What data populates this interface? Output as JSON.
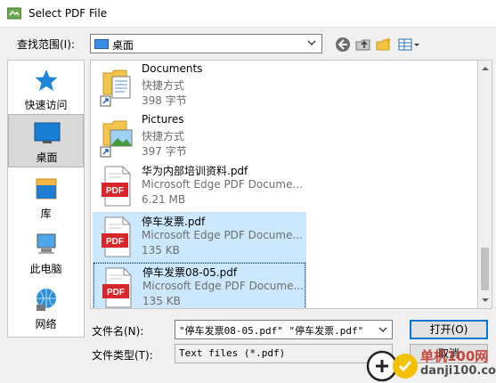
{
  "window": {
    "title": "Select PDF File"
  },
  "toolbar": {
    "lookin_label": "查找范围(I):",
    "lookin_value": "桌面"
  },
  "places": [
    {
      "label": "快速访问",
      "icon": "star-icon"
    },
    {
      "label": "桌面",
      "icon": "desktop-icon",
      "selected": true
    },
    {
      "label": "库",
      "icon": "library-icon"
    },
    {
      "label": "此电脑",
      "icon": "computer-icon"
    },
    {
      "label": "网络",
      "icon": "network-icon"
    }
  ],
  "files": [
    {
      "name": "Documents",
      "type": "快捷方式",
      "size": "398 字节",
      "icon": "shortcut-documents-icon"
    },
    {
      "name": "Pictures",
      "type": "快捷方式",
      "size": "397 字节",
      "icon": "shortcut-pictures-icon"
    },
    {
      "name": "华为内部培训资料.pdf",
      "type": "Microsoft Edge PDF Docume...",
      "size": "6.21 MB",
      "icon": "pdf-file-icon"
    },
    {
      "name": "停车发票.pdf",
      "type": "Microsoft Edge PDF Docume...",
      "size": "135 KB",
      "icon": "pdf-file-icon",
      "selected": true
    },
    {
      "name": "停车发票08-05.pdf",
      "type": "Microsoft Edge PDF Docume...",
      "size": "135 KB",
      "icon": "pdf-file-icon",
      "selected": true,
      "focused": true
    }
  ],
  "form": {
    "filename_label": "文件名(N):",
    "filename_value": "\"停车发票08-05.pdf\" \"停车发票.pdf\"",
    "filetype_label": "文件类型(T):",
    "filetype_value": "Text files (*.pdf)"
  },
  "buttons": {
    "open": "打开(O)",
    "cancel": "取消"
  },
  "watermark": {
    "text": "单机100网",
    "url": "danji100.com"
  },
  "colors": {
    "selection": "#cce8ff",
    "accent": "#0078d7",
    "pdf_red": "#d9262b"
  }
}
